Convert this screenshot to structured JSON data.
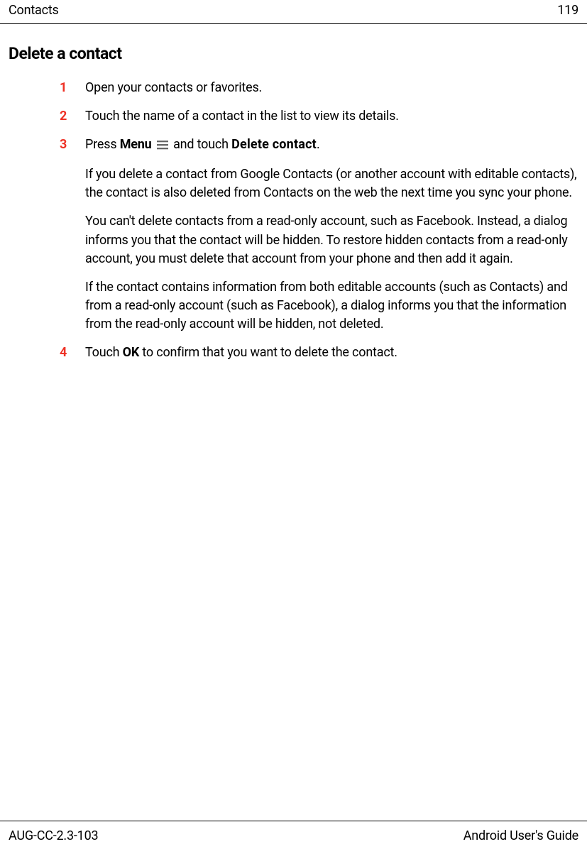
{
  "header": {
    "section": "Contacts",
    "page_number": "119"
  },
  "section_title": "Delete a contact",
  "steps": {
    "s1": {
      "num": "1",
      "text": "Open your contacts or favorites."
    },
    "s2": {
      "num": "2",
      "text": "Touch the name of a contact in the list to view its details."
    },
    "s3": {
      "num": "3",
      "pre": "Press ",
      "bold1": "Menu",
      "mid": " and touch ",
      "bold2": "Delete contact",
      "post": ".",
      "para1": "If you delete a contact from Google Contacts (or another account with editable contacts), the contact is also deleted from Contacts on the web the next time you sync your phone.",
      "para2": "You can't delete contacts from a read-only account, such as Facebook. Instead, a dialog informs you that the contact will be hidden. To restore hidden contacts from a read-only account, you must delete that account from your phone and then add it again.",
      "para3": "If the contact contains information from both editable accounts (such as Contacts) and from a read-only account (such as Facebook), a dialog informs you that the information from the read-only account will be hidden, not deleted."
    },
    "s4": {
      "num": "4",
      "pre": "Touch ",
      "bold1": "OK",
      "post": " to confirm that you want to delete the contact."
    }
  },
  "footer": {
    "doc_id": "AUG-CC-2.3-103",
    "guide": "Android User's Guide"
  }
}
